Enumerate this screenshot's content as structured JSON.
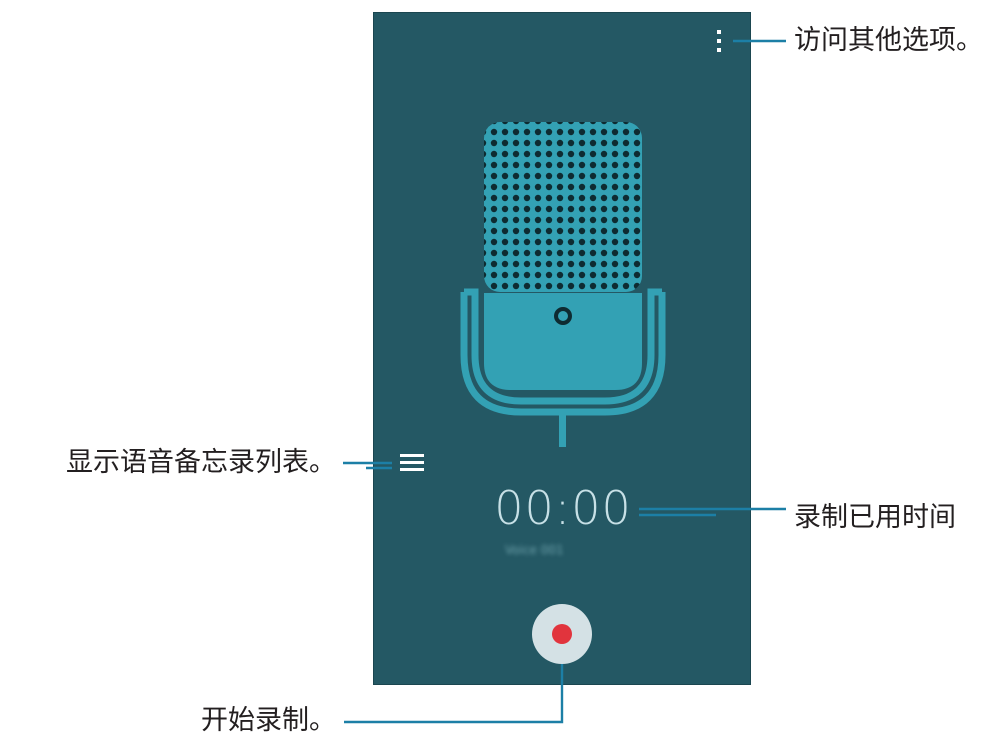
{
  "app": {
    "timer": "00:00",
    "file_name": "Voice 001"
  },
  "icons": {
    "more": "more-vertical-icon",
    "list": "list-icon",
    "record": "record-icon",
    "microphone": "microphone-icon"
  },
  "colors": {
    "screen_background": "#245864",
    "accent": "#2f9bb0",
    "record_dot": "#e1343d",
    "leader_line": "#1c7fa6"
  },
  "callouts": {
    "more_options": "访问其他选项。",
    "elapsed_time": "录制已用时间",
    "recordings_list": "显示语音备忘录列表。",
    "start_recording": "开始录制。"
  }
}
